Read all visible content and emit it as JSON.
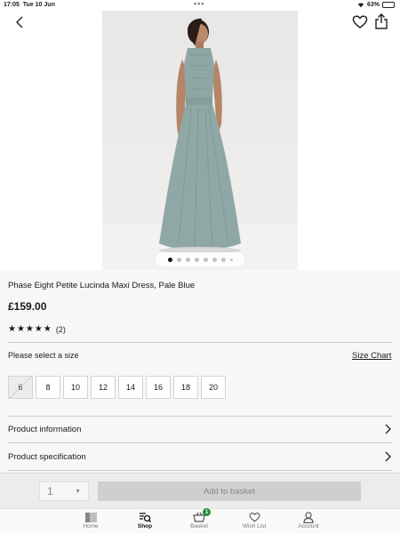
{
  "status_bar": {
    "time": "17:05",
    "date": "Tue 10 Jun",
    "battery": "63%",
    "battery_level": 0.63
  },
  "product": {
    "title": "Phase Eight Petite Lucinda Maxi Dress, Pale Blue",
    "price": "£159.00",
    "rating_stars": "★★★★★",
    "rating_count": "(2)",
    "image_count": 8,
    "image_index": 1
  },
  "sizes": {
    "label": "Please select a size",
    "chart_link": "Size Chart",
    "options": [
      {
        "label": "6",
        "available": false
      },
      {
        "label": "8",
        "available": true
      },
      {
        "label": "10",
        "available": true
      },
      {
        "label": "12",
        "available": true
      },
      {
        "label": "14",
        "available": true
      },
      {
        "label": "16",
        "available": true
      },
      {
        "label": "18",
        "available": true
      },
      {
        "label": "20",
        "available": true
      }
    ]
  },
  "sections": {
    "product_information": "Product information",
    "product_specification": "Product specification"
  },
  "basket": {
    "quantity": "1",
    "add_label": "Add to basket",
    "badge_count": "1"
  },
  "tabs": {
    "home": "Home",
    "shop": "Shop",
    "basket": "Basket",
    "wishlist": "Wish List",
    "account": "Account"
  },
  "colors": {
    "dress": "#8fa8a6",
    "badge": "#1f8f3a"
  }
}
